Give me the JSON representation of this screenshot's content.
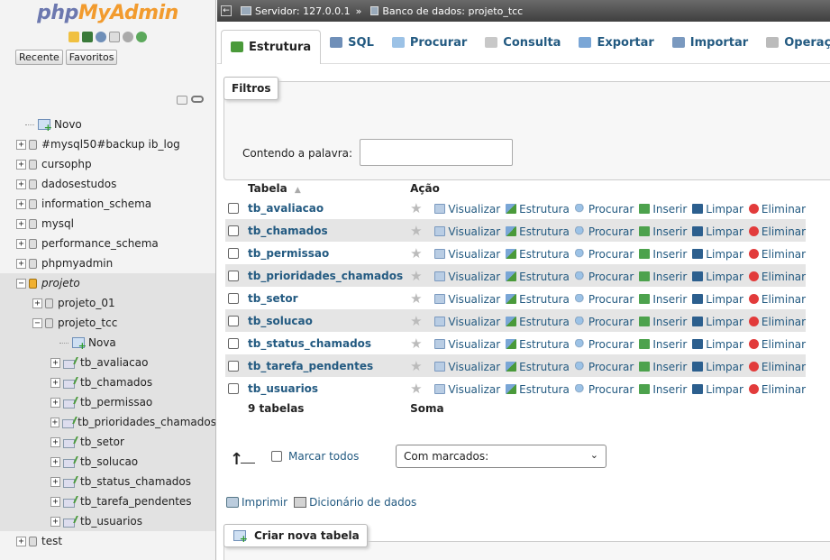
{
  "logo": {
    "part1": "php",
    "part2": "MyAdmin"
  },
  "nav": {
    "tabs": [
      "Recente",
      "Favoritos"
    ],
    "tree": [
      {
        "label": "Novo",
        "type": "new",
        "indent": 0
      },
      {
        "label": "#mysql50#backup ib_log",
        "type": "db",
        "indent": 0
      },
      {
        "label": "cursophp",
        "type": "db",
        "indent": 0
      },
      {
        "label": "dadosestudos",
        "type": "db",
        "indent": 0
      },
      {
        "label": "information_schema",
        "type": "db",
        "indent": 0
      },
      {
        "label": "mysql",
        "type": "db",
        "indent": 0
      },
      {
        "label": "performance_schema",
        "type": "db",
        "indent": 0
      },
      {
        "label": "phpmyadmin",
        "type": "db",
        "indent": 0
      },
      {
        "label": "projeto",
        "type": "group",
        "indent": 0
      },
      {
        "label": "projeto_01",
        "type": "db",
        "indent": 1
      },
      {
        "label": "projeto_tcc",
        "type": "db-open",
        "indent": 1
      },
      {
        "label": "Nova",
        "type": "new",
        "indent": 2
      },
      {
        "label": "tb_avaliacao",
        "type": "table",
        "indent": 2
      },
      {
        "label": "tb_chamados",
        "type": "table",
        "indent": 2
      },
      {
        "label": "tb_permissao",
        "type": "table",
        "indent": 2
      },
      {
        "label": "tb_prioridades_chamados",
        "type": "table",
        "indent": 2
      },
      {
        "label": "tb_setor",
        "type": "table",
        "indent": 2
      },
      {
        "label": "tb_solucao",
        "type": "table",
        "indent": 2
      },
      {
        "label": "tb_status_chamados",
        "type": "table",
        "indent": 2
      },
      {
        "label": "tb_tarefa_pendentes",
        "type": "table",
        "indent": 2
      },
      {
        "label": "tb_usuarios",
        "type": "table",
        "indent": 2
      },
      {
        "label": "test",
        "type": "db",
        "indent": 0
      }
    ]
  },
  "breadcrumb": {
    "server": "Servidor: 127.0.0.1",
    "separator": "»",
    "database": "Banco de dados: projeto_tcc"
  },
  "tabs": [
    {
      "label": "Estrutura",
      "active": true,
      "color": "#4a9a3a"
    },
    {
      "label": "SQL",
      "active": false,
      "color": "#6f8fb8"
    },
    {
      "label": "Procurar",
      "active": false,
      "color": "#9cc2e6"
    },
    {
      "label": "Consulta",
      "active": false,
      "color": "#c8c8c8"
    },
    {
      "label": "Exportar",
      "active": false,
      "color": "#7aa6d6"
    },
    {
      "label": "Importar",
      "active": false,
      "color": "#7a99bf"
    },
    {
      "label": "Operações",
      "active": false,
      "color": "#bbbbbb"
    }
  ],
  "filter": {
    "legend": "Filtros",
    "label": "Contendo a palavra:",
    "value": ""
  },
  "table": {
    "headers": {
      "table": "Tabela",
      "sort_icon": "▲",
      "action": "Ação"
    },
    "actions": [
      "Visualizar",
      "Estrutura",
      "Procurar",
      "Inserir",
      "Limpar",
      "Eliminar"
    ],
    "rows": [
      "tb_avaliacao",
      "tb_chamados",
      "tb_permissao",
      "tb_prioridades_chamados",
      "tb_setor",
      "tb_solucao",
      "tb_status_chamados",
      "tb_tarefa_pendentes",
      "tb_usuarios"
    ],
    "summary": {
      "count": "9 tabelas",
      "sum": "Soma"
    }
  },
  "bulk": {
    "check_all": "Marcar todos",
    "select_value": "Com marcados:"
  },
  "links": {
    "print": "Imprimir",
    "dictionary": "Dicionário de dados"
  },
  "create": {
    "label": "Criar nova tabela"
  },
  "colors": {
    "link": "#235a81",
    "header_bar": "#4f4f4f",
    "row_alt": "#e5e5e5"
  }
}
